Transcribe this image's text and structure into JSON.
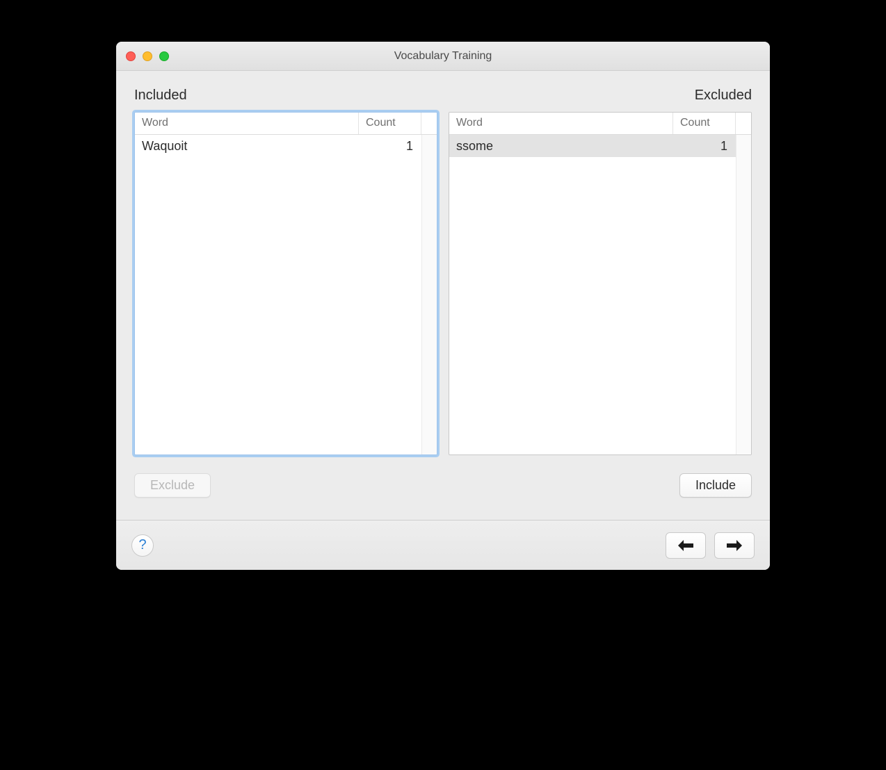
{
  "window": {
    "title": "Vocabulary Training"
  },
  "sections": {
    "included_label": "Included",
    "excluded_label": "Excluded"
  },
  "columns": {
    "word": "Word",
    "count": "Count"
  },
  "included": {
    "rows": [
      {
        "word": "Waquoit",
        "count": "1"
      }
    ]
  },
  "excluded": {
    "rows": [
      {
        "word": "ssome",
        "count": "1"
      }
    ]
  },
  "buttons": {
    "exclude": "Exclude",
    "include": "Include"
  },
  "footer": {
    "help": "?"
  }
}
